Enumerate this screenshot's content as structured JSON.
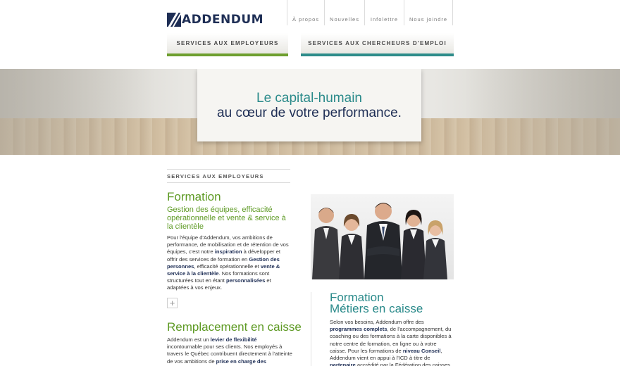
{
  "brand": {
    "logo_text": "ADDENDUM"
  },
  "nav": {
    "items": [
      {
        "label": "À propos"
      },
      {
        "label": "Nouvelles"
      },
      {
        "label": "Infolettre"
      },
      {
        "label": "Nous joindre"
      }
    ]
  },
  "services": {
    "employers": "SERVICES AUX EMPLOYEURS",
    "seekers": "SERVICES AUX CHERCHEURS D'EMPLOI"
  },
  "hero": {
    "line1": "Le capital-humain",
    "line2": "au cœur de votre performance."
  },
  "left": {
    "section_label": "SERVICES AUX EMPLOYEURS",
    "formation_title": "Formation",
    "formation_subtitle": "Gestion des équipes, efficacité opérationnelle et vente & service à la clientèle",
    "formation_para": [
      {
        "t": "Pour l'équipe d'Addendum, vos ambitions de performance, de mobilisation et de rétention de vos équipes, c'est notre ",
        "b": false
      },
      {
        "t": "inspiration",
        "b": true
      },
      {
        "t": " à développer et offrir des services de formation en ",
        "b": false
      },
      {
        "t": "Gestion des personnes",
        "b": true
      },
      {
        "t": ", efficacité opérationnelle et ",
        "b": false
      },
      {
        "t": "vente & service à la clientèle",
        "b": true
      },
      {
        "t": ". Nos formations sont structurées tout en étant ",
        "b": false
      },
      {
        "t": "personnalisées",
        "b": true
      },
      {
        "t": " et adaptées à vos enjeux.",
        "b": false
      }
    ],
    "plus_symbol": "+",
    "remplacement_title": "Remplacement en caisse",
    "remplacement_para": [
      {
        "t": "Addendum est un ",
        "b": false
      },
      {
        "t": "levier de flexibilité",
        "b": true
      },
      {
        "t": " incontournable pour ses clients.  Nos employés à travers le Québec contribuent directement à l'atteinte de vos ambitions de ",
        "b": false
      },
      {
        "t": "prise en charge des",
        "b": true
      }
    ]
  },
  "right": {
    "metiers_title_line1": "Formation",
    "metiers_title_line2": "Métiers en caisse",
    "metiers_para": [
      {
        "t": "Selon vos besoins, Addendum offre des ",
        "b": false
      },
      {
        "t": "programmes complets",
        "b": true
      },
      {
        "t": ", de l'accompagnement, du coaching ou des formations à la carte disponibles à notre centre de formation, en ligne ou à votre caisse. Pour les formations de ",
        "b": false
      },
      {
        "t": "niveau Conseil",
        "b": true
      },
      {
        "t": ", Addendum vient en appui à l'ICD à titre de ",
        "b": false
      },
      {
        "t": "partenaire",
        "b": true
      },
      {
        "t": " accrédité par la Fédération des caisses",
        "b": false
      }
    ]
  },
  "colors": {
    "navy": "#1e2e55",
    "green": "#5e9a24",
    "teal": "#2a8a8a"
  }
}
